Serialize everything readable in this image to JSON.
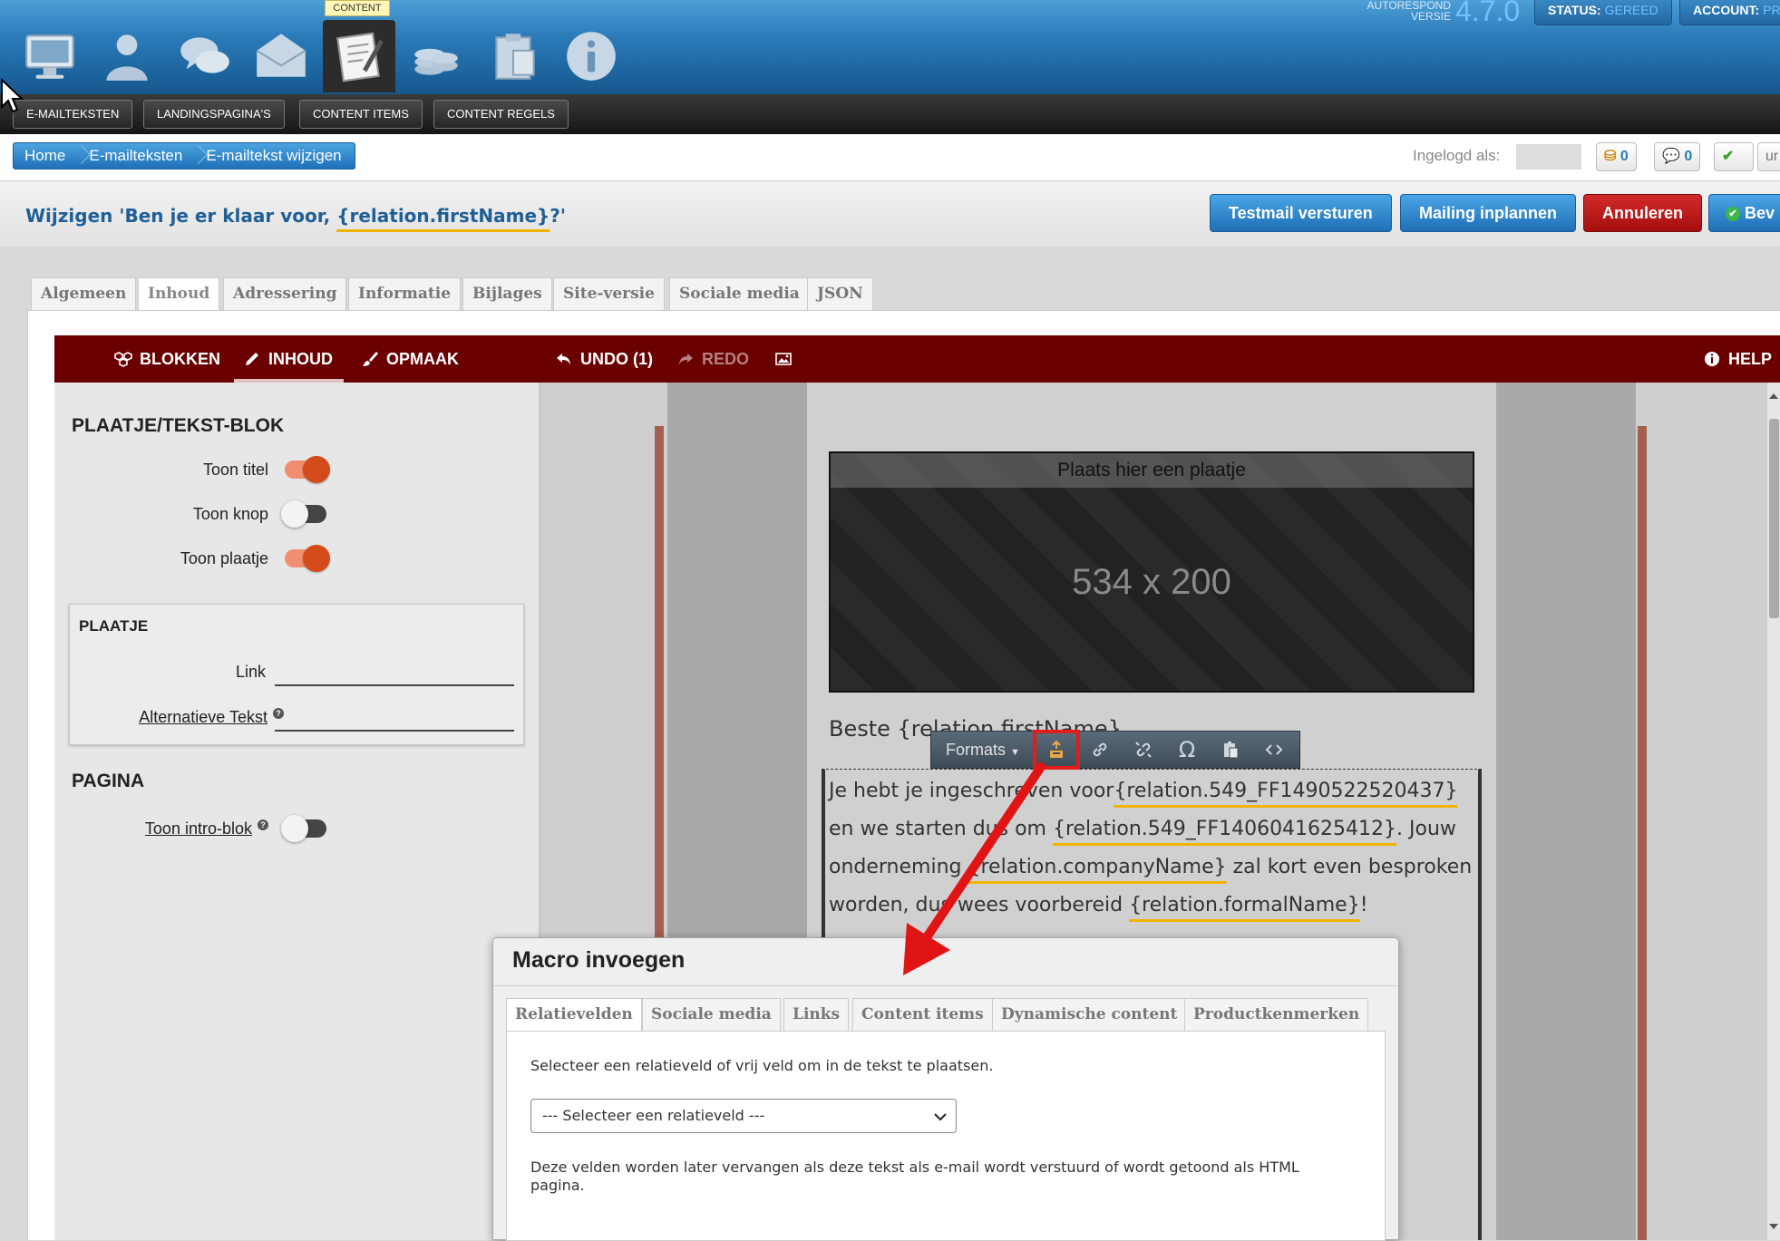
{
  "topbar": {
    "content_tip": "CONTENT",
    "autorespond_label_1": "AUTORESPOND",
    "autorespond_label_2": "VERSIE",
    "version": "4.7.0",
    "status_label": "STATUS:",
    "status_value": "GEREED",
    "account_label": "ACCOUNT:",
    "account_value": "PR",
    "nav_icons": [
      "monitor-icon",
      "person-icon",
      "chat-icon",
      "envelope-icon",
      "content-notepad-icon",
      "coins-icon",
      "clipboard-icon",
      "info-icon"
    ]
  },
  "submenu": [
    "E-MAILTEKSTEN",
    "LANDINGSPAGINA'S",
    "CONTENT ITEMS",
    "CONTENT REGELS"
  ],
  "breadcrumb": [
    "Home",
    "E-mailteksten",
    "E-mailtekst wijzigen"
  ],
  "user_status": {
    "logged_in_label": "Ingelogd als:",
    "credits_count": "0",
    "messages_count": "0",
    "trailing": "ur"
  },
  "title": {
    "prefix": "Wijzigen 'Ben je er klaar voor, ",
    "macro": "{relation.firstName}",
    "suffix": "?'"
  },
  "actions": {
    "testmail": "Testmail versturen",
    "schedule": "Mailing inplannen",
    "cancel": "Annuleren",
    "save": "Bev"
  },
  "tabs": [
    "Algemeen",
    "Inhoud",
    "Adressering",
    "Informatie",
    "Bijlages",
    "Site-versie",
    "Sociale media",
    "JSON"
  ],
  "active_tab": "Inhoud",
  "editor_toolbar": {
    "blocks": "BLOKKEN",
    "content": "INHOUD",
    "style": "OPMAAK",
    "undo": "UNDO (1)",
    "redo": "REDO",
    "help": "HELP"
  },
  "settings": {
    "block_heading": "PLAATJE/TEKST-BLOK",
    "toggles": [
      {
        "label": "Toon titel",
        "on": true
      },
      {
        "label": "Toon knop",
        "on": false
      },
      {
        "label": "Toon plaatje",
        "on": true
      }
    ],
    "image_heading": "PLAATJE",
    "link_label": "Link",
    "link_value": "",
    "alt_label": "Alternatieve Tekst",
    "alt_value": "",
    "page_heading": "PAGINA",
    "intro_label": "Toon intro-blok",
    "intro_on": false
  },
  "canvas": {
    "image_title": "Plaats hier een plaatje",
    "image_size": "534 x 200",
    "greeting": "Beste {relation.firstName}",
    "body": {
      "t1": "Je hebt je ingeschreven voor",
      "m1": "{relation.549_FF1490522520437}",
      "t2": "en we starten dus om ",
      "m2": "{relation.549_FF1406041625412}",
      "t3": ". Jouw onderneming ",
      "m3": "{relation.companyName}",
      "t4": " zal kort even besproken worden, dus wees voorbereid ",
      "m4": "{relation.formalName}",
      "t5": "!"
    },
    "format_toolbar": {
      "formats_label": "Formats",
      "tools": [
        "insert-macro-icon",
        "link-icon",
        "unlink-icon",
        "omega-special-char-icon",
        "paste-icon",
        "source-code-icon"
      ]
    }
  },
  "macro_dialog": {
    "title": "Macro invoegen",
    "tabs": [
      "Relatievelden",
      "Sociale media",
      "Links",
      "Content items",
      "Dynamische content",
      "Productkenmerken"
    ],
    "active_tab": "Relatievelden",
    "instruction": "Selecteer een relatieveld of vrij veld om in de tekst te plaatsen.",
    "select_value": "--- Selecteer een relatieveld ---",
    "note": "Deze velden worden later vervangen als deze tekst als e-mail wordt verstuurd of wordt getoond als HTML pagina."
  },
  "colors": {
    "brand_blue": "#2a7ab8",
    "editor_red": "#6b0000",
    "macro_underline": "#f0b400",
    "highlight_red": "#e21b1b",
    "toggle_on": "#d54a1a"
  }
}
